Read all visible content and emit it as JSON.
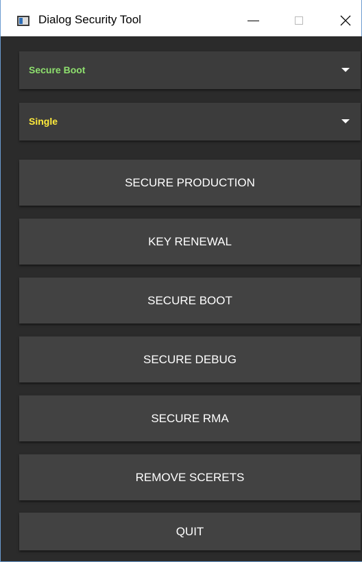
{
  "window": {
    "title": "Dialog Security Tool",
    "accent_border_color": "#6b9bd0"
  },
  "dropdowns": [
    {
      "selected": "Secure Boot",
      "color": "#8ee06e"
    },
    {
      "selected": "Single",
      "color": "#ffeb3b"
    }
  ],
  "buttons": {
    "secure_production": "SECURE PRODUCTION",
    "key_renewal": "KEY RENEWAL",
    "secure_boot": "SECURE BOOT",
    "secure_debug": "SECURE DEBUG",
    "secure_rma": "SECURE RMA",
    "remove_secrets": "REMOVE SCERETS",
    "quit": "QUIT"
  },
  "icons": {
    "app": "app-window-icon",
    "minimize": "minimize-icon",
    "maximize": "maximize-icon",
    "close": "close-icon",
    "dropdown_arrow": "caret-down-icon"
  },
  "colors": {
    "background": "#2b2b2b",
    "button": "#424242",
    "dropdown": "#3c3c3c",
    "button_text": "#ffffff"
  }
}
